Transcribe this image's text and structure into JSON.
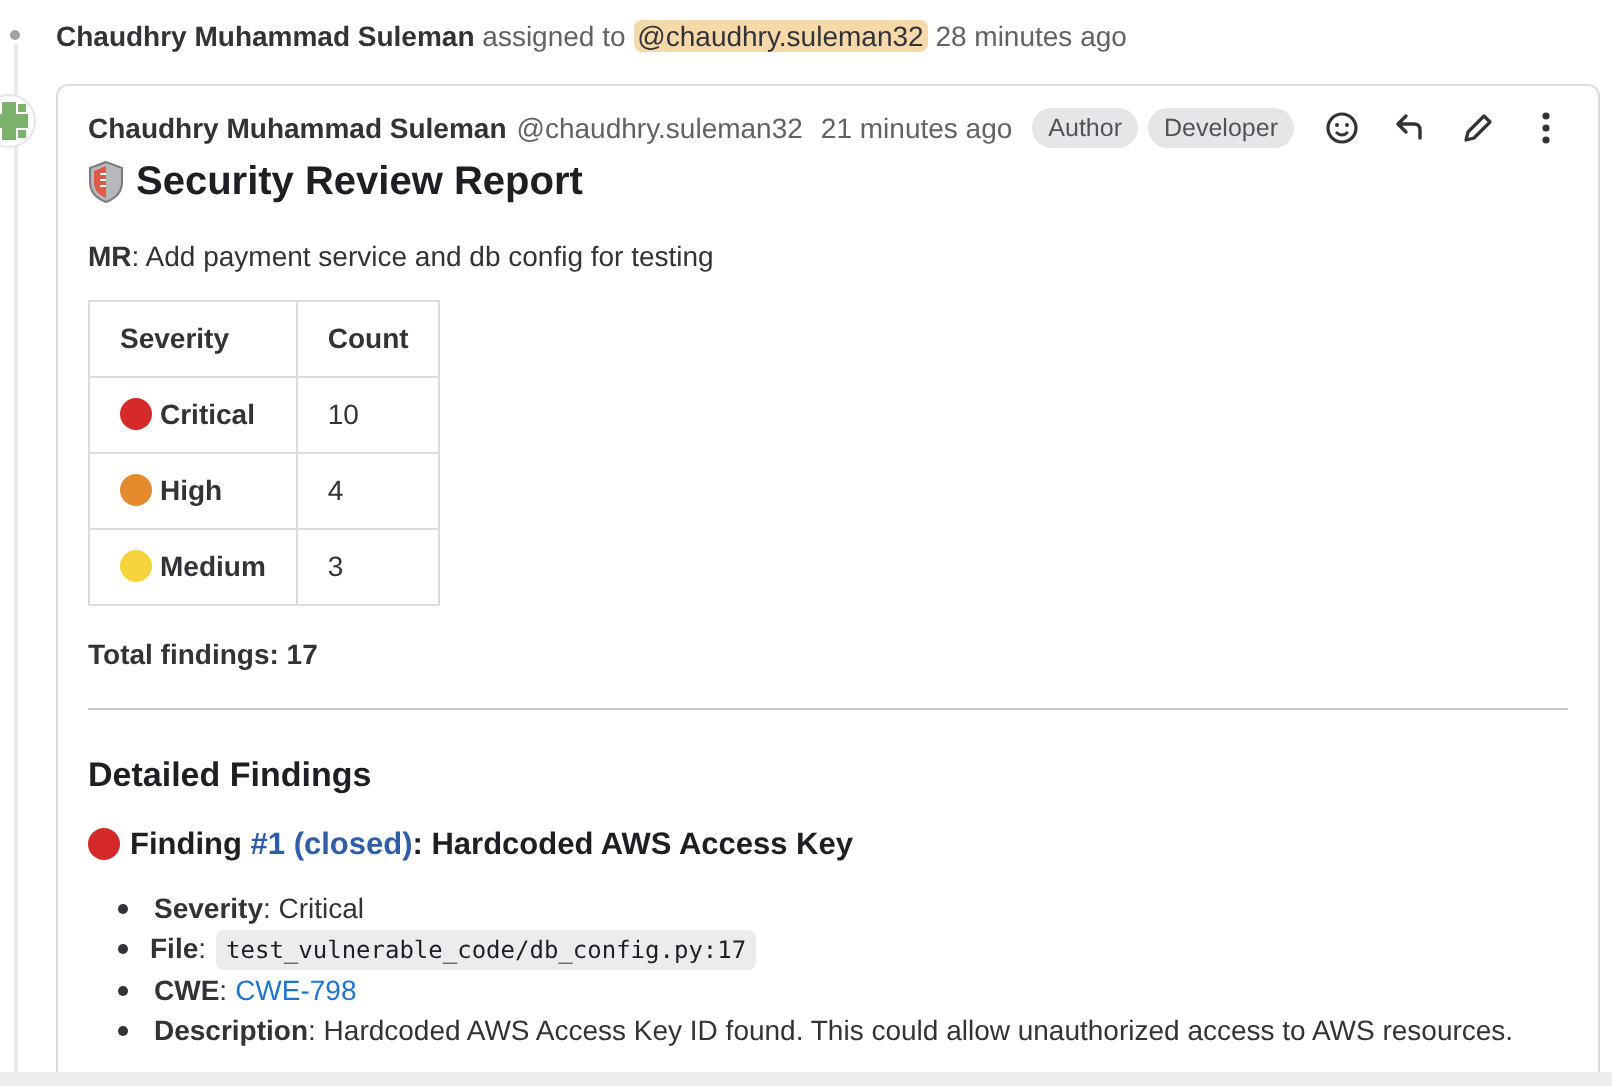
{
  "system_note": {
    "author": "Chaudhry Muhammad Suleman",
    "action": "assigned to",
    "mention": "@chaudhry.suleman32",
    "time": "28 minutes ago"
  },
  "comment": {
    "author": "Chaudhry Muhammad Suleman",
    "username": "@chaudhry.suleman32",
    "time": "21 minutes ago",
    "badges": [
      "Author",
      "Developer"
    ],
    "title": "Security Review Report",
    "mr": "**MR**: Add payment service and db config for testing",
    "severity_table": {
      "columns": [
        "Severity",
        "Count"
      ],
      "rows": [
        {
          "severity": "Critical",
          "color": "#d42a2a",
          "count": "10"
        },
        {
          "severity": "High",
          "color": "#e68a2e",
          "count": "4"
        },
        {
          "severity": "Medium",
          "color": "#f7d33c",
          "count": "3"
        }
      ]
    },
    "total": "Total findings: 17",
    "section_title": "Detailed Findings",
    "finding": {
      "color": "#d42a2a",
      "prefix": "Finding",
      "link": "#1 (closed)",
      "suffix": ": Hardcoded AWS Access Key",
      "details": [
        {
          "kind": "text",
          "text": "**Severity**: Critical"
        },
        {
          "kind": "code",
          "label": "**File**:",
          "value": "test_vulnerable_code/db_config.py:17"
        },
        {
          "kind": "link",
          "label": "**CWE**:",
          "value": "CWE-798"
        },
        {
          "kind": "text",
          "text": "**Description**: Hardcoded AWS Access Key ID found. This could allow unauthorized access to AWS resources."
        }
      ]
    }
  }
}
